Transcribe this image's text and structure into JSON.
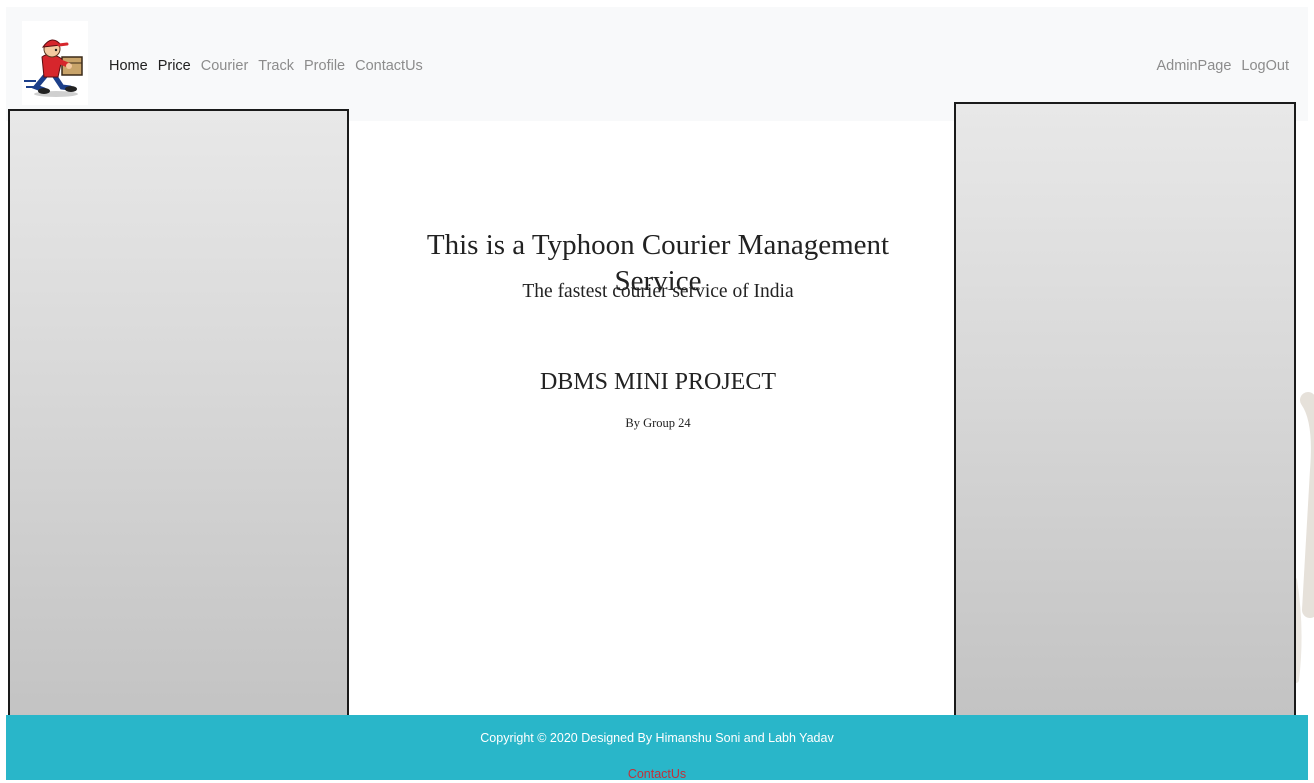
{
  "nav": {
    "left_links": [
      {
        "label": "Home"
      },
      {
        "label": "Price"
      },
      {
        "label": "Courier"
      },
      {
        "label": "Track"
      },
      {
        "label": "Profile"
      },
      {
        "label": "ContactUs"
      }
    ],
    "right_links": [
      {
        "label": "AdminPage"
      },
      {
        "label": "LogOut"
      }
    ]
  },
  "hero": {
    "title": "This is a Typhoon Courier Management Service",
    "subtitle": "The fastest courier service of India",
    "project": "DBMS MINI PROJECT",
    "group": "By Group 24"
  },
  "footer": {
    "copyright": "Copyright © 2020 Designed By Himanshu Soni and Labh Yadav",
    "contact_link": "ContactUs"
  },
  "colors": {
    "navbar_bg": "#f8f9fa",
    "footer_bg": "#29b6c9",
    "footer_link": "#c1323a",
    "nav_active": "#212121",
    "nav_inactive": "#8c8c8c"
  },
  "icons": {
    "logo": "courier-delivery-man-icon"
  }
}
